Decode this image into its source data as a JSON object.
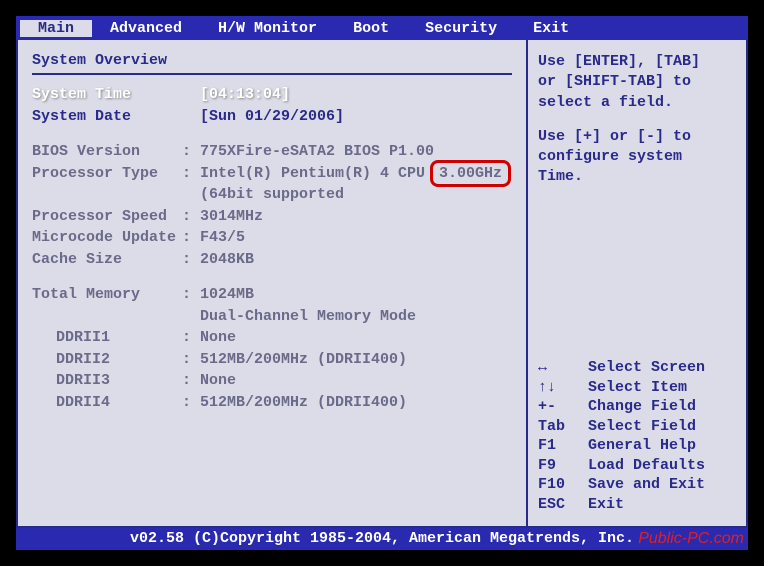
{
  "menubar": {
    "items": [
      {
        "label": "Main",
        "active": true
      },
      {
        "label": "Advanced",
        "active": false
      },
      {
        "label": "H/W Monitor",
        "active": false
      },
      {
        "label": "Boot",
        "active": false
      },
      {
        "label": "Security",
        "active": false
      },
      {
        "label": "Exit",
        "active": false
      }
    ]
  },
  "main": {
    "heading": "System Overview",
    "system_time": {
      "label": "System Time",
      "value": "[04:13:04]"
    },
    "system_date": {
      "label": "System Date",
      "value": "[Sun 01/29/2006]"
    },
    "bios_version": {
      "label": "BIOS Version",
      "value": "775XFire-eSATA2 BIOS P1.00"
    },
    "processor_type": {
      "label": "Processor Type",
      "value_pre": "Intel(R) Pentium(R) 4 CPU",
      "value_highlight": "3.00GHz",
      "sub": "(64bit supported"
    },
    "processor_speed": {
      "label": "Processor Speed",
      "value": "3014MHz"
    },
    "microcode_update": {
      "label": "Microcode Update",
      "value": "F43/5"
    },
    "cache_size": {
      "label": "Cache Size",
      "value": "2048KB"
    },
    "total_memory": {
      "label": "Total Memory",
      "value": "1024MB",
      "sub": "Dual-Channel Memory Mode"
    },
    "slots": [
      {
        "label": "DDRII1",
        "value": "None"
      },
      {
        "label": "DDRII2",
        "value": "512MB/200MHz (DDRII400)"
      },
      {
        "label": "DDRII3",
        "value": "None"
      },
      {
        "label": "DDRII4",
        "value": "512MB/200MHz (DDRII400)"
      }
    ]
  },
  "help": {
    "line1": "Use [ENTER], [TAB]",
    "line2": "or [SHIFT-TAB] to",
    "line3": "select a field.",
    "line4": "Use [+] or [-] to",
    "line5": "configure system Time.",
    "keys": [
      {
        "key": "↔",
        "desc": "Select Screen"
      },
      {
        "key": "↑↓",
        "desc": "Select Item"
      },
      {
        "key": "+-",
        "desc": "Change Field"
      },
      {
        "key": "Tab",
        "desc": "Select Field"
      },
      {
        "key": "F1",
        "desc": "General Help"
      },
      {
        "key": "F9",
        "desc": "Load Defaults"
      },
      {
        "key": "F10",
        "desc": "Save and Exit"
      },
      {
        "key": "ESC",
        "desc": "Exit"
      }
    ]
  },
  "footer": "v02.58 (C)Copyright 1985-2004, American Megatrends, Inc.",
  "watermark": "Public-PC.com"
}
